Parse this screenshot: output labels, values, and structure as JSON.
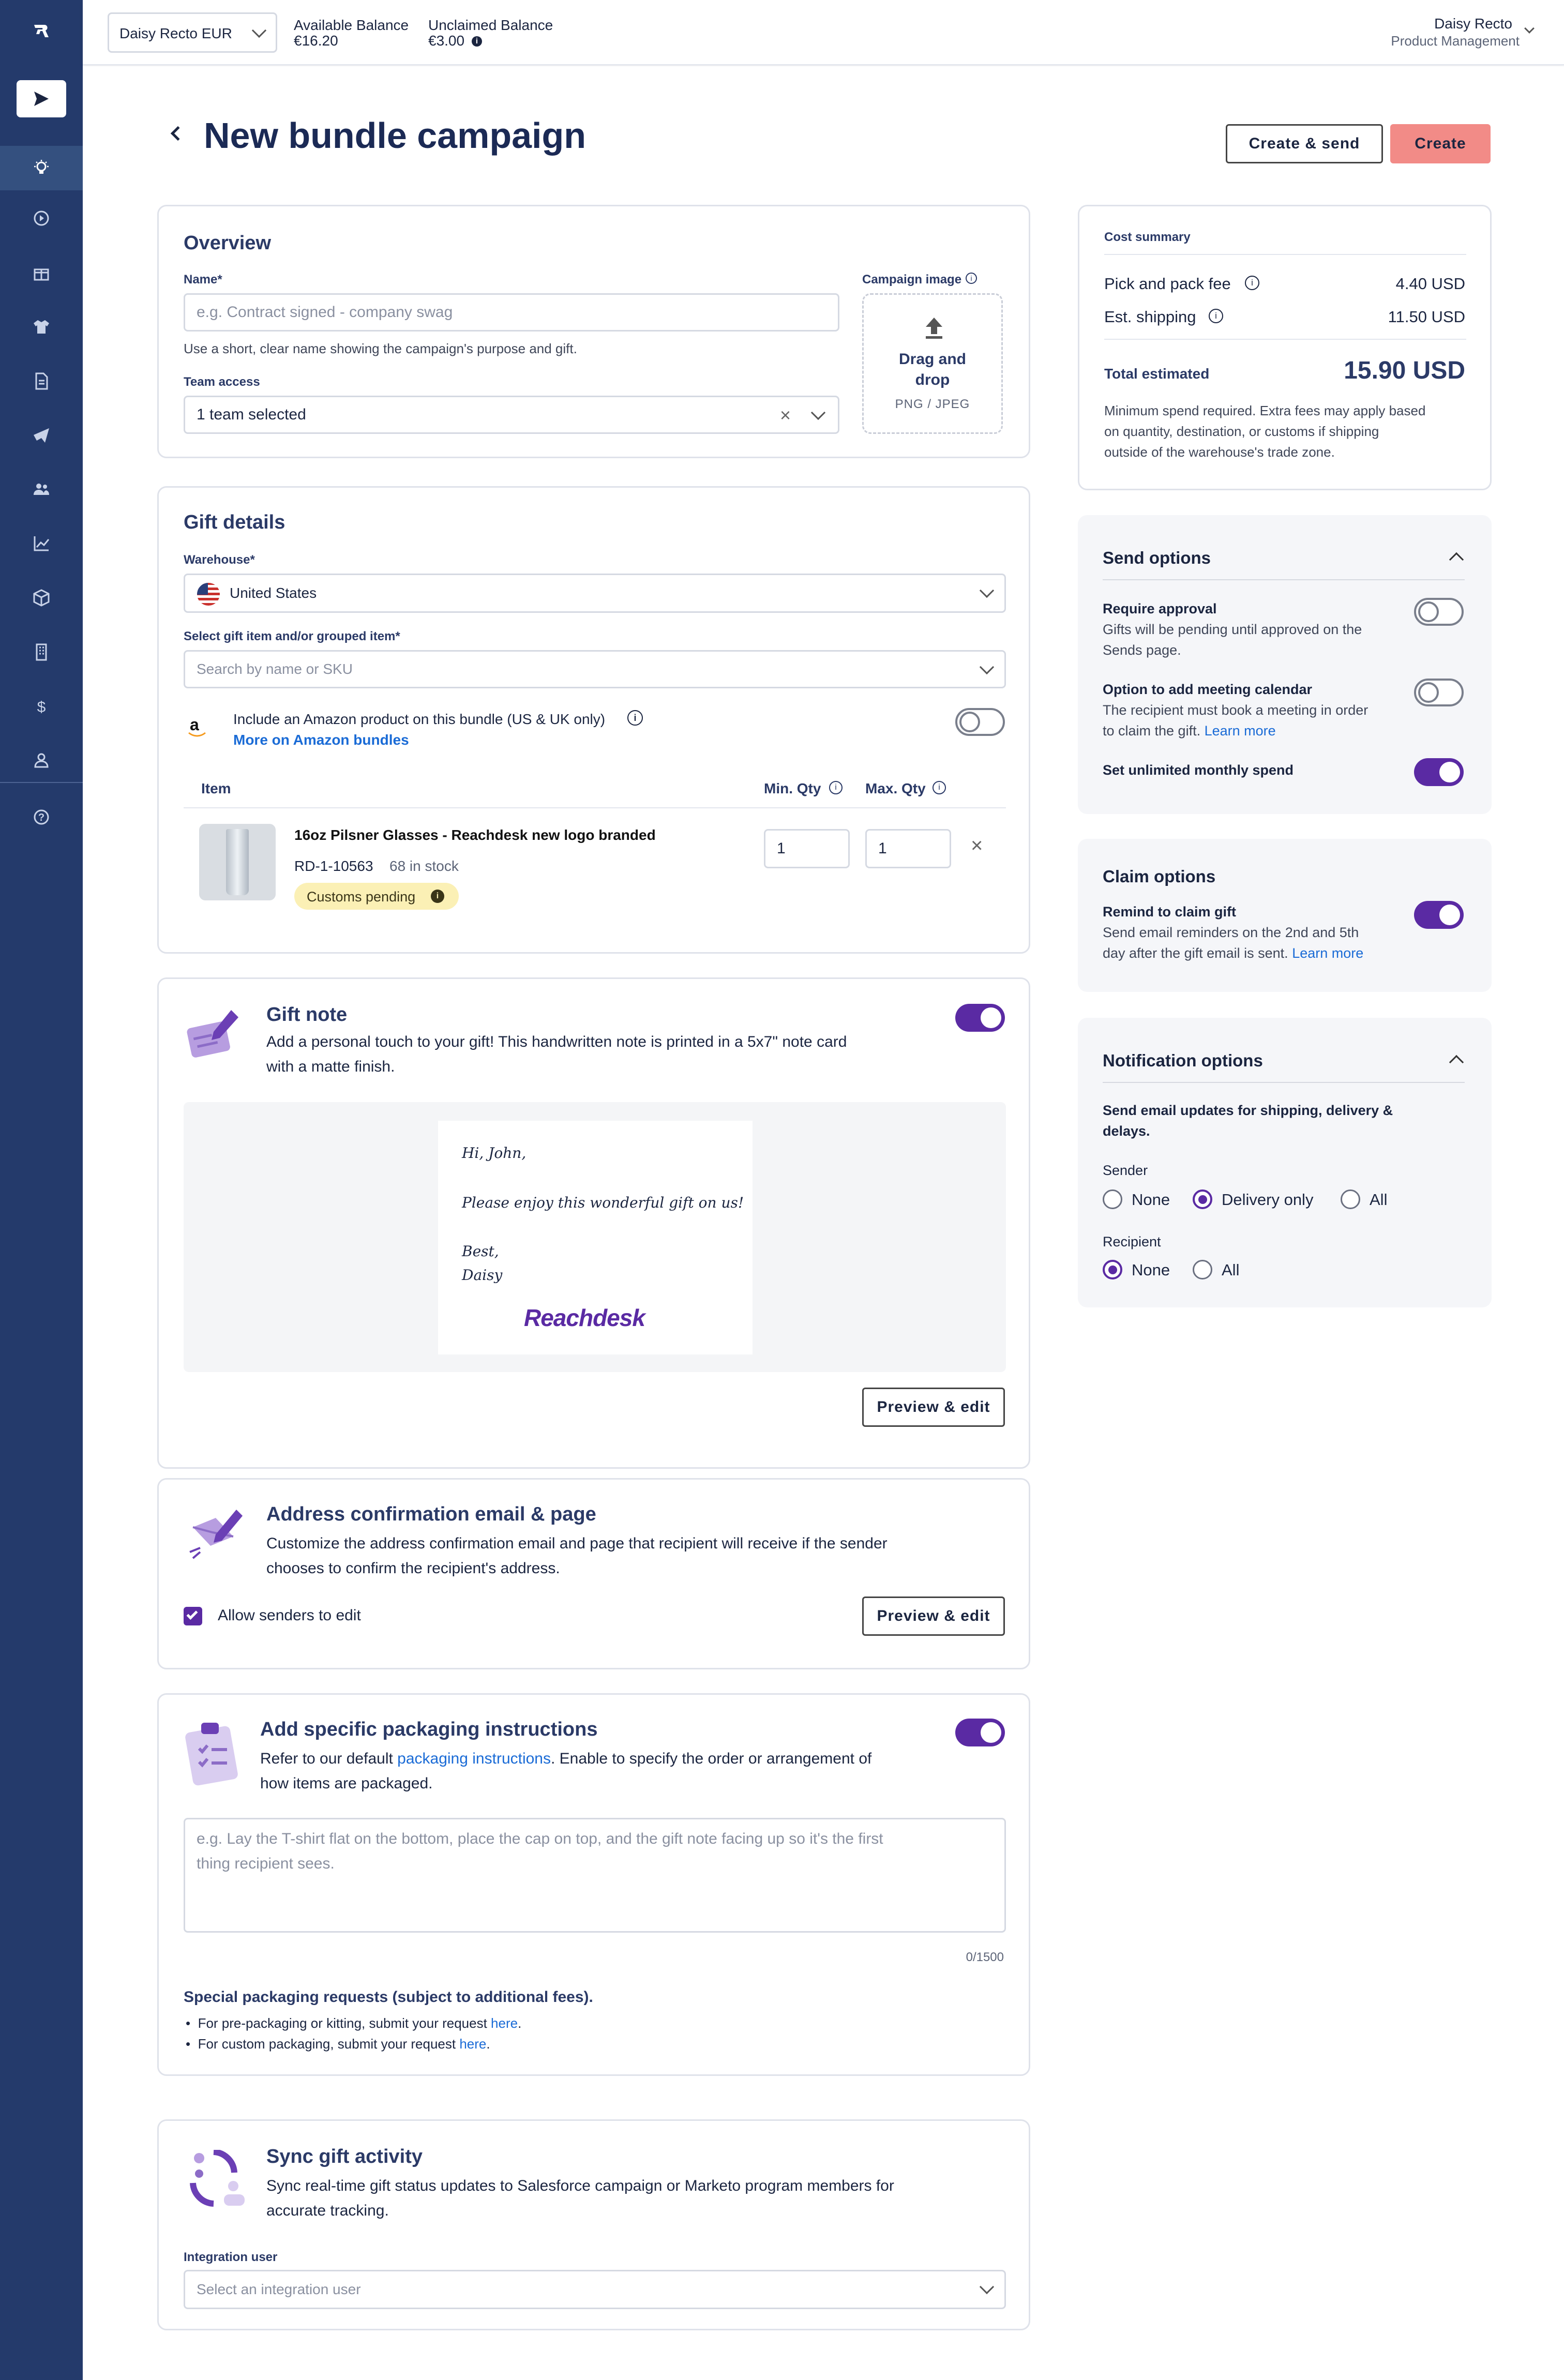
{
  "topbar": {
    "account_select": "Daisy Recto EUR",
    "available_label": "Available Balance",
    "available_value": "€16.20",
    "unclaimed_label": "Unclaimed Balance",
    "unclaimed_value": "€3.00",
    "user_name": "Daisy Recto",
    "user_role": "Product Management"
  },
  "page": {
    "title": "New bundle campaign",
    "create_send_label": "Create & send",
    "create_label": "Create"
  },
  "overview": {
    "title": "Overview",
    "name_label": "Name*",
    "name_placeholder": "e.g. Contract signed - company swag",
    "name_hint": "Use a short, clear name showing the campaign's purpose and gift.",
    "team_label": "Team access",
    "team_value": "1 team selected",
    "image_label": "Campaign image",
    "drop_line1": "Drag and",
    "drop_line2": "drop",
    "drop_formats": "PNG / JPEG"
  },
  "gift_details": {
    "title": "Gift details",
    "warehouse_label": "Warehouse*",
    "warehouse_value": "United States",
    "select_label": "Select gift item and/or grouped item*",
    "select_placeholder": "Search by name or SKU",
    "amazon_text": "Include an Amazon product on this bundle (US & UK only)",
    "amazon_link": "More on Amazon bundles",
    "col_item": "Item",
    "col_min": "Min. Qty",
    "col_max": "Max. Qty",
    "item_name": "16oz Pilsner Glasses - Reachdesk new logo branded",
    "item_sku": "RD-1-10563",
    "item_stock": "68 in stock",
    "item_badge": "Customs pending",
    "min_qty": "1",
    "max_qty": "1"
  },
  "gift_note": {
    "title": "Gift note",
    "desc1": "Add a personal touch to your gift! This handwritten note is printed in a 5x7\" note card",
    "desc2": "with a matte finish.",
    "note_line1": "Hi, John,",
    "note_line2": "Please enjoy this wonderful gift on us!",
    "note_line3": "Best,",
    "note_line4": "Daisy",
    "logo": "Reachdesk",
    "preview_label": "Preview & edit"
  },
  "address": {
    "title": "Address confirmation email & page",
    "desc1": "Customize the address confirmation email and page that recipient will receive if the sender",
    "desc2": "chooses to confirm the recipient's address.",
    "checkbox_label": "Allow senders to edit",
    "preview_label": "Preview & edit"
  },
  "packaging": {
    "title": "Add specific packaging instructions",
    "desc_pre": "Refer to our default ",
    "desc_link": "packaging instructions",
    "desc_post": ". Enable to specify the order or arrangement of",
    "desc2": "how items are packaged.",
    "placeholder1": "e.g. Lay the T-shirt flat on the bottom, place the cap on top, and the gift note facing up so it's the first",
    "placeholder2": "thing recipient sees.",
    "counter": "0/1500",
    "special_title": "Special packaging requests (subject to additional fees).",
    "bullet1_pre": "For pre-packaging or kitting, submit your request ",
    "bullet2_pre": "For custom packaging, submit your request ",
    "here": "here",
    "dot": "."
  },
  "sync": {
    "title": "Sync gift activity",
    "desc1": "Sync real-time gift status updates to Salesforce campaign or Marketo program members for",
    "desc2": "accurate tracking.",
    "integration_label": "Integration user",
    "integration_placeholder": "Select an integration user"
  },
  "cost": {
    "title": "Cost summary",
    "pick_label": "Pick and pack fee",
    "pick_value": "4.40 USD",
    "shipping_label": "Est. shipping",
    "shipping_value": "11.50 USD",
    "total_label": "Total estimated",
    "total_value": "15.90 USD",
    "note1": "Minimum spend required. Extra fees may apply based",
    "note2": "on quantity, destination, or customs if shipping",
    "note3": "outside of the warehouse's trade zone."
  },
  "send_options": {
    "title": "Send options",
    "approval_title": "Require approval",
    "approval_desc1": "Gifts will be pending until approved on the",
    "approval_desc2": "Sends page.",
    "meeting_title": "Option to add meeting calendar",
    "meeting_desc1": "The recipient must book a meeting in order",
    "meeting_desc2": "to claim the gift.",
    "learn_more": "Learn more",
    "unlimited": "Set unlimited monthly spend"
  },
  "claim_options": {
    "title": "Claim options",
    "remind_title": "Remind to claim gift",
    "remind_desc1": "Send email reminders on the 2nd and 5th",
    "remind_desc2": "day after the gift email is sent.",
    "learn_more": "Learn more"
  },
  "notification": {
    "title": "Notification options",
    "desc1": "Send email updates for shipping, delivery &",
    "desc2": "delays.",
    "sender_label": "Sender",
    "recipient_label": "Recipient",
    "opt_none": "None",
    "opt_delivery": "Delivery only",
    "opt_all": "All"
  },
  "colors": {
    "sidebar": "#243a6b",
    "accent_purple": "#5a2aa3",
    "create_button": "#f28b87",
    "link": "#1a6bd6",
    "badge": "#fbf0b5"
  }
}
